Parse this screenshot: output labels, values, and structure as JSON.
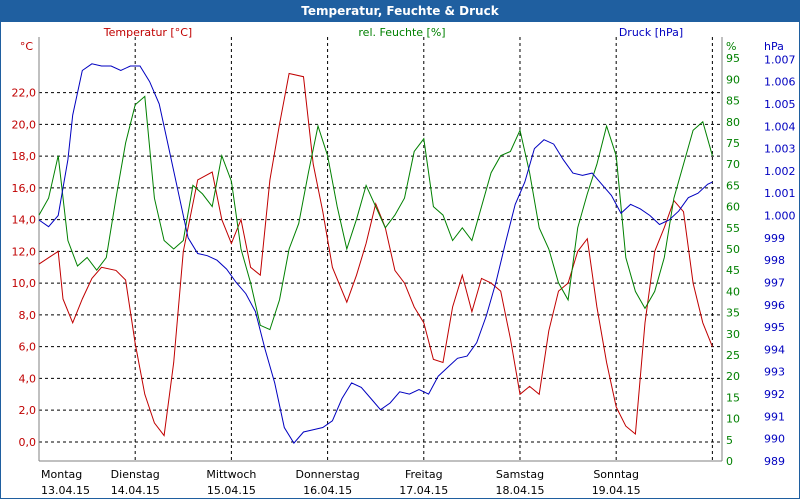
{
  "window": {
    "title": "Temperatur, Feuchte & Druck"
  },
  "colors": {
    "temperature": "#c00000",
    "humidity": "#008000",
    "pressure": "#0000c0",
    "titlebar": "#1f5fa0"
  },
  "chart_data": {
    "type": "line",
    "title": "Temperatur, Feuchte & Druck",
    "x_unit_labels": [
      {
        "day": "Montag",
        "date": "13.04.15"
      },
      {
        "day": "Dienstag",
        "date": "14.04.15"
      },
      {
        "day": "Mittwoch",
        "date": "15.04.15"
      },
      {
        "day": "Donnerstag",
        "date": "16.04.15"
      },
      {
        "day": "Freitag",
        "date": "17.04.15"
      },
      {
        "day": "Samstag",
        "date": "18.04.15"
      },
      {
        "day": "Sonntag",
        "date": "19.04.15"
      }
    ],
    "xlim": [
      0,
      7.1
    ],
    "grid": true,
    "axes": {
      "temperature": {
        "label": "Temperatur [°C]",
        "unit": "°C",
        "ylim": [
          -1.2,
          25.5
        ],
        "ticks": [
          "0,0",
          "2,0",
          "4,0",
          "6,0",
          "8,0",
          "10,0",
          "12,0",
          "14,0",
          "16,0",
          "18,0",
          "20,0",
          "22,0"
        ],
        "tick_values": [
          0,
          2,
          4,
          6,
          8,
          10,
          12,
          14,
          16,
          18,
          20,
          22
        ]
      },
      "humidity": {
        "label": "rel. Feuchte [%]",
        "unit": "%",
        "ylim": [
          0,
          100
        ],
        "ticks": [
          "0",
          "5",
          "10",
          "15",
          "20",
          "25",
          "30",
          "35",
          "40",
          "45",
          "50",
          "55",
          "60",
          "65",
          "70",
          "75",
          "80",
          "85",
          "90",
          "95"
        ],
        "tick_values": [
          0,
          5,
          10,
          15,
          20,
          25,
          30,
          35,
          40,
          45,
          50,
          55,
          60,
          65,
          70,
          75,
          80,
          85,
          90,
          95
        ]
      },
      "pressure": {
        "label": "Druck [hPa]",
        "unit": "hPa",
        "ylim": [
          989,
          1008
        ],
        "ticks": [
          "989",
          "990",
          "991",
          "992",
          "993",
          "994",
          "995",
          "996",
          "997",
          "998",
          "999",
          "1.000",
          "1.001",
          "1.002",
          "1.003",
          "1.004",
          "1.005",
          "1.006",
          "1.007"
        ],
        "tick_values": [
          989,
          990,
          991,
          992,
          993,
          994,
          995,
          996,
          997,
          998,
          999,
          1000,
          1001,
          1002,
          1003,
          1004,
          1005,
          1006,
          1007
        ]
      }
    },
    "series": [
      {
        "name": "Temperatur [°C]",
        "axis": "temperature",
        "x": [
          0.0,
          0.1,
          0.2,
          0.25,
          0.35,
          0.45,
          0.55,
          0.65,
          0.8,
          0.9,
          1.0,
          1.1,
          1.2,
          1.3,
          1.4,
          1.5,
          1.65,
          1.8,
          1.9,
          2.0,
          2.1,
          2.2,
          2.3,
          2.4,
          2.5,
          2.6,
          2.75,
          2.85,
          2.95,
          3.05,
          3.2,
          3.3,
          3.4,
          3.5,
          3.6,
          3.7,
          3.8,
          3.9,
          4.0,
          4.1,
          4.2,
          4.3,
          4.4,
          4.5,
          4.6,
          4.7,
          4.8,
          4.9,
          5.0,
          5.1,
          5.2,
          5.3,
          5.4,
          5.5,
          5.6,
          5.7,
          5.8,
          5.9,
          6.0,
          6.1,
          6.2,
          6.3,
          6.4,
          6.5,
          6.6,
          6.7,
          6.8,
          6.9,
          7.0
        ],
        "values": [
          11.2,
          11.6,
          12.0,
          9.0,
          7.5,
          9.0,
          10.3,
          11.0,
          10.8,
          10.2,
          6.2,
          3.0,
          1.2,
          0.4,
          5.0,
          12.0,
          16.5,
          17.0,
          14.0,
          12.5,
          14.0,
          11.0,
          10.5,
          16.5,
          20.0,
          23.2,
          23.0,
          17.5,
          14.5,
          11.0,
          8.8,
          10.5,
          12.5,
          15.0,
          13.5,
          10.8,
          10.0,
          8.5,
          7.5,
          5.2,
          5.0,
          8.5,
          10.5,
          8.2,
          10.3,
          10.0,
          9.5,
          6.5,
          3.0,
          3.5,
          3.0,
          7.0,
          9.5,
          10.0,
          12.0,
          12.8,
          8.5,
          5.0,
          2.2,
          1.0,
          0.5,
          7.5,
          12.0,
          13.5,
          15.2,
          14.5,
          10.0,
          7.5,
          6.0
        ]
      },
      {
        "name": "rel. Feuchte [%]",
        "axis": "humidity",
        "x": [
          0.0,
          0.1,
          0.2,
          0.3,
          0.4,
          0.5,
          0.6,
          0.7,
          0.8,
          0.9,
          1.0,
          1.1,
          1.2,
          1.3,
          1.4,
          1.5,
          1.6,
          1.7,
          1.8,
          1.9,
          2.0,
          2.1,
          2.2,
          2.3,
          2.4,
          2.5,
          2.6,
          2.7,
          2.8,
          2.9,
          3.0,
          3.1,
          3.2,
          3.3,
          3.4,
          3.5,
          3.6,
          3.7,
          3.8,
          3.9,
          4.0,
          4.1,
          4.2,
          4.3,
          4.4,
          4.5,
          4.6,
          4.7,
          4.8,
          4.9,
          5.0,
          5.1,
          5.2,
          5.3,
          5.4,
          5.5,
          5.6,
          5.7,
          5.8,
          5.9,
          6.0,
          6.1,
          6.2,
          6.3,
          6.4,
          6.5,
          6.6,
          6.7,
          6.8,
          6.9,
          7.0
        ],
        "values": [
          58,
          62,
          72,
          52,
          46,
          48,
          45,
          48,
          62,
          75,
          84,
          86,
          62,
          52,
          50,
          52,
          65,
          63,
          60,
          72,
          66,
          50,
          42,
          32,
          31,
          38,
          50,
          56,
          68,
          79,
          72,
          60,
          50,
          57,
          65,
          60,
          55,
          58,
          62,
          73,
          76,
          60,
          58,
          52,
          55,
          52,
          60,
          68,
          72,
          73,
          78,
          68,
          55,
          50,
          42,
          38,
          55,
          63,
          70,
          79,
          72,
          48,
          40,
          36,
          40,
          48,
          62,
          70,
          78,
          80,
          72
        ]
      },
      {
        "name": "Druck [hPa]",
        "axis": "pressure",
        "x": [
          0.0,
          0.1,
          0.2,
          0.3,
          0.35,
          0.45,
          0.55,
          0.65,
          0.75,
          0.85,
          0.95,
          1.05,
          1.15,
          1.25,
          1.35,
          1.45,
          1.55,
          1.65,
          1.75,
          1.85,
          1.95,
          2.05,
          2.15,
          2.25,
          2.35,
          2.45,
          2.55,
          2.65,
          2.75,
          2.85,
          2.95,
          3.05,
          3.15,
          3.25,
          3.35,
          3.45,
          3.55,
          3.65,
          3.75,
          3.85,
          3.95,
          4.05,
          4.15,
          4.25,
          4.35,
          4.45,
          4.55,
          4.65,
          4.75,
          4.85,
          4.95,
          5.05,
          5.15,
          5.25,
          5.35,
          5.45,
          5.55,
          5.65,
          5.75,
          5.85,
          5.95,
          6.05,
          6.15,
          6.25,
          6.35,
          6.45,
          6.55,
          6.65,
          6.75,
          6.85,
          6.95,
          7.0
        ],
        "values": [
          999.8,
          999.5,
          1000.0,
          1002.5,
          1004.5,
          1006.5,
          1006.8,
          1006.7,
          1006.7,
          1006.5,
          1006.7,
          1006.7,
          1006.0,
          1005.0,
          1003.0,
          1001.0,
          999.0,
          998.3,
          998.2,
          998.0,
          997.6,
          997.0,
          996.5,
          995.7,
          994.0,
          992.5,
          990.5,
          989.8,
          990.3,
          990.4,
          990.5,
          990.8,
          991.8,
          992.5,
          992.3,
          991.8,
          991.3,
          991.6,
          992.1,
          992.0,
          992.2,
          992.0,
          992.8,
          993.2,
          993.6,
          993.7,
          994.3,
          995.5,
          997.0,
          998.8,
          1000.5,
          1001.5,
          1003.0,
          1003.4,
          1003.2,
          1002.5,
          1001.9,
          1001.8,
          1001.9,
          1001.4,
          1000.9,
          1000.1,
          1000.5,
          1000.3,
          1000.0,
          999.6,
          999.8,
          1000.2,
          1000.8,
          1001.0,
          1001.4,
          1001.5
        ]
      }
    ]
  }
}
